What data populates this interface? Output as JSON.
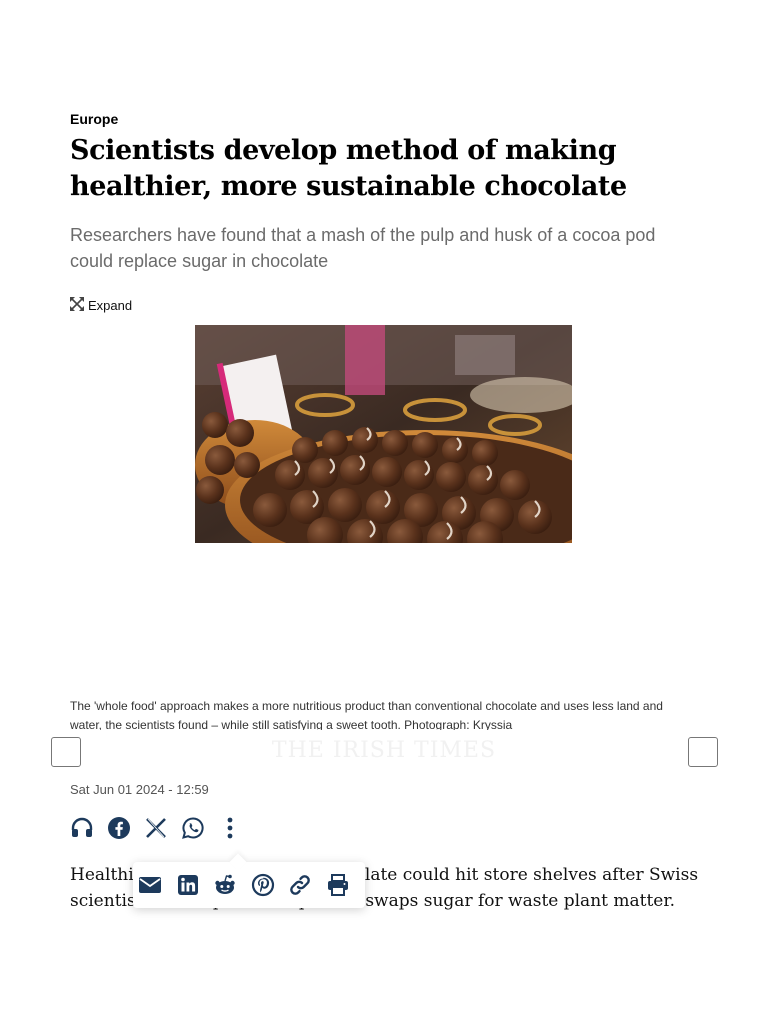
{
  "article": {
    "section": "Europe",
    "headline": "Scientists develop method of making healthier, more sustainable chocolate",
    "subheadline": "Researchers have found that a mash of the pulp and husk of a cocoa pod could replace sugar in chocolate",
    "expand_label": "Expand",
    "caption": "The 'whole food' approach makes a more nutritious product than conventional chocolate and uses less land and water, the scientists found – while still satisfying a sweet tooth. Photograph: Kryssia",
    "brand": "THE IRISH TIMES",
    "timestamp": "Sat Jun 01 2024 - 12:59",
    "body_first": "Healthier, more sustainable chocolate could hit store shelves after Swiss scientists developed a recipe that swaps sugar for waste plant matter."
  },
  "share_row": {
    "icons": [
      "headphones-icon",
      "facebook-icon",
      "x-icon",
      "whatsapp-icon",
      "more-vertical-icon"
    ]
  },
  "share_popover": {
    "icons": [
      "email-icon",
      "linkedin-icon",
      "reddit-icon",
      "pinterest-icon",
      "link-icon",
      "print-icon"
    ]
  },
  "colors": {
    "icon": "#1d3a5c",
    "headline": "#000000",
    "subheadline": "#6b6b6b"
  }
}
